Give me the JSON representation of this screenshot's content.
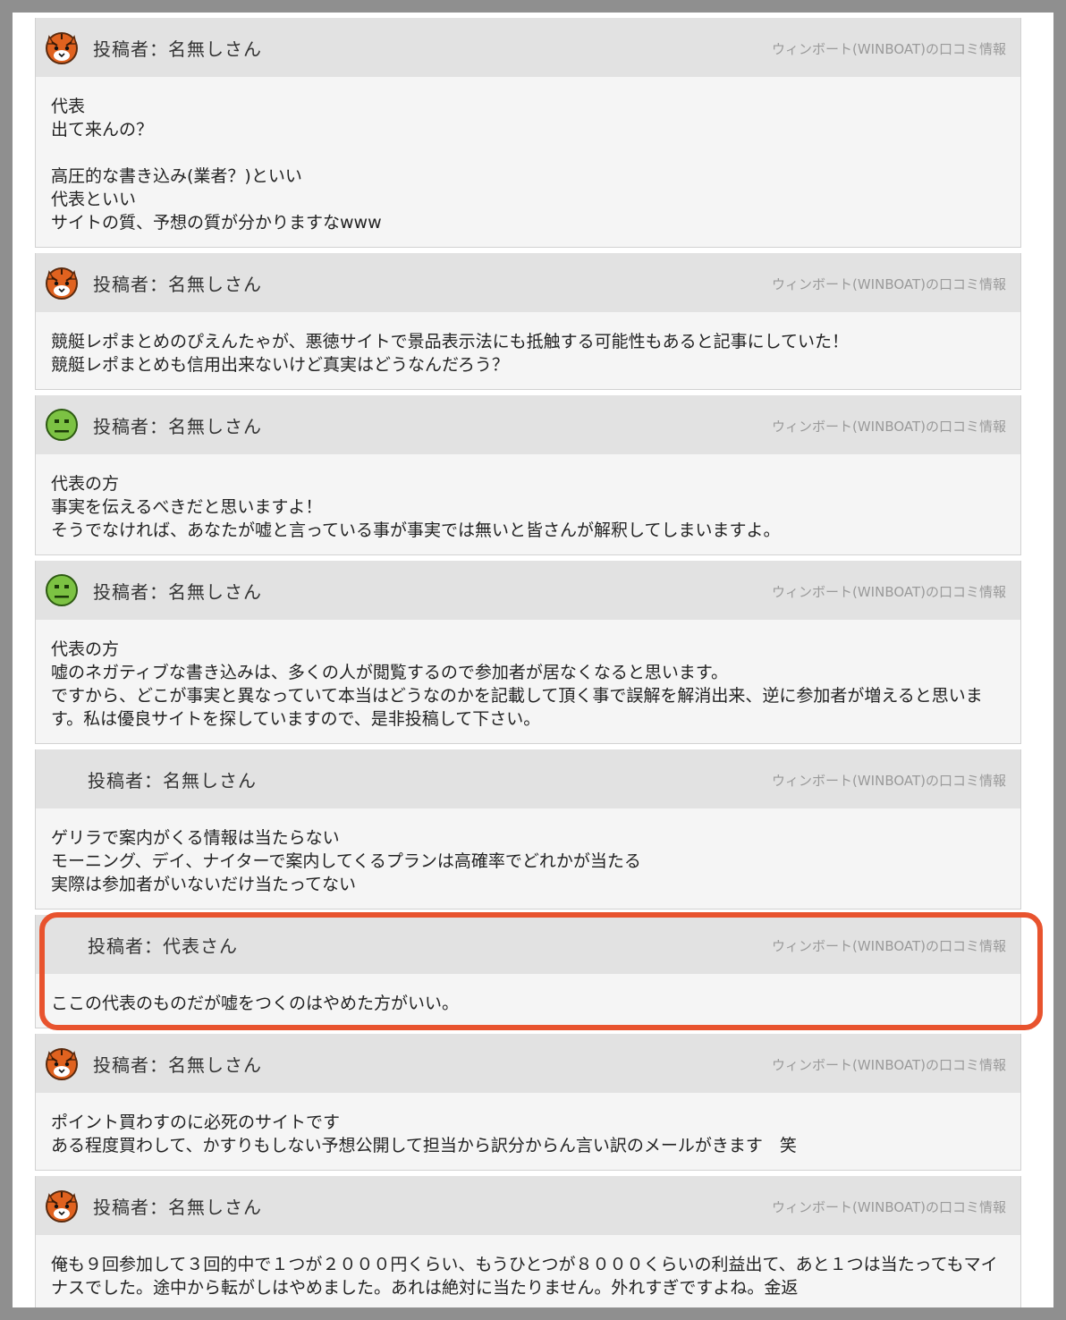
{
  "source_label": "ウィンボート(WINBOAT)の口コミ情報",
  "colors": {
    "highlight": "#e8532e",
    "header_bg": "#e2e2e2",
    "body_bg": "#f5f5f5"
  },
  "posts": [
    {
      "avatar": "tiger-icon",
      "poster": "投稿者：名無しさん",
      "body": [
        "代表",
        "出て来んの？",
        "",
        "高圧的な書き込み(業者？)といい",
        "代表といい",
        "サイトの質、予想の質が分かりますなwww"
      ]
    },
    {
      "avatar": "tiger-icon",
      "poster": "投稿者：名無しさん",
      "body": [
        "競艇レポまとめのぴえんたゃが、悪徳サイトで景品表示法にも抵触する可能性もあると記事にしていた！",
        "競艇レポまとめも信用出来ないけど真実はどうなんだろう？"
      ]
    },
    {
      "avatar": "green-face-icon",
      "poster": "投稿者：名無しさん",
      "body": [
        "代表の方",
        "事実を伝えるべきだと思いますよ！",
        "そうでなければ、あなたが嘘と言っている事が事実では無いと皆さんが解釈してしまいますよ。"
      ]
    },
    {
      "avatar": "green-face-icon",
      "poster": "投稿者：名無しさん",
      "body": [
        "代表の方",
        "嘘のネガティブな書き込みは、多くの人が閲覧するので参加者が居なくなると思います。",
        "ですから、どこが事実と異なっていて本当はどうなのかを記載して頂く事で誤解を解消出来、逆に参加者が増えると思います。私は優良サイトを探していますので、是非投稿して下さい。"
      ]
    },
    {
      "avatar": "none",
      "poster": "投稿者：名無しさん",
      "body": [
        "ゲリラで案内がくる情報は当たらない",
        "モーニング、デイ、ナイターで案内してくるプランは高確率でどれかが当たる",
        "実際は参加者がいないだけ当たってない"
      ]
    },
    {
      "avatar": "none",
      "poster": "投稿者：代表さん",
      "highlighted": true,
      "body": [
        "ここの代表のものだが嘘をつくのはやめた方がいい。"
      ]
    },
    {
      "avatar": "tiger-icon",
      "poster": "投稿者：名無しさん",
      "body": [
        "ポイント買わすのに必死のサイトです",
        "ある程度買わして、かすりもしない予想公開して担当から訳分からん言い訳のメールがきます　笑"
      ]
    },
    {
      "avatar": "tiger-icon",
      "poster": "投稿者：名無しさん",
      "body": [
        "俺も９回参加して３回的中で１つが２０００円くらい、もうひとつが８０００くらいの利益出て、あと１つは当たってもマイナスでした。途中から転がしはやめました。あれは絶対に当たりません。外れすぎですよね。金返"
      ]
    }
  ]
}
